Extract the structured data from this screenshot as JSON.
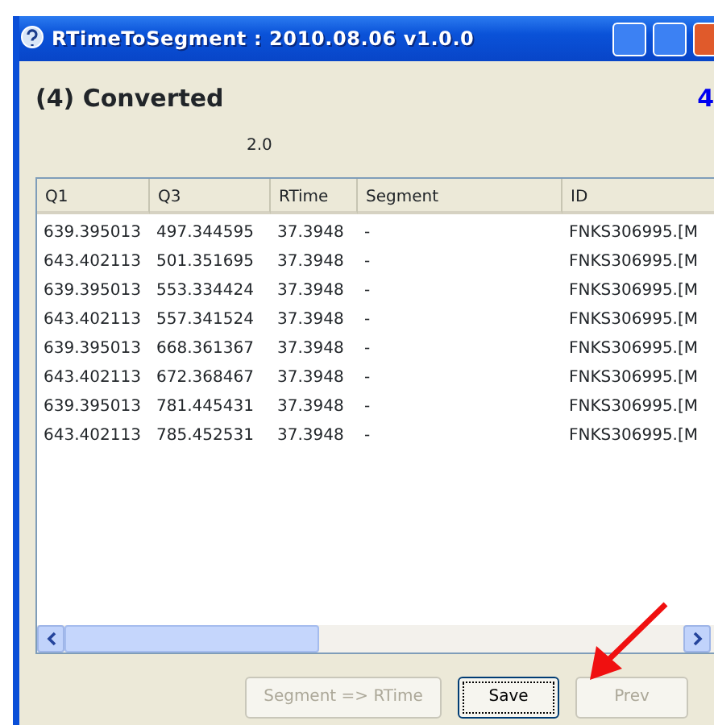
{
  "window": {
    "title": "RTimeToSegment : 2010.08.06 v1.0.0"
  },
  "heading": "(4) Converted",
  "step_number": "4",
  "version_label": "2.0",
  "table": {
    "columns": [
      "Q1",
      "Q3",
      "RTime",
      "Segment",
      "ID"
    ],
    "rows": [
      [
        "639.395013",
        "497.344595",
        "37.3948",
        "-",
        "FNKS306995.[M"
      ],
      [
        "643.402113",
        "501.351695",
        "37.3948",
        "-",
        "FNKS306995.[M"
      ],
      [
        "639.395013",
        "553.334424",
        "37.3948",
        "-",
        "FNKS306995.[M"
      ],
      [
        "643.402113",
        "557.341524",
        "37.3948",
        "-",
        "FNKS306995.[M"
      ],
      [
        "639.395013",
        "668.361367",
        "37.3948",
        "-",
        "FNKS306995.[M"
      ],
      [
        "643.402113",
        "672.368467",
        "37.3948",
        "-",
        "FNKS306995.[M"
      ],
      [
        "639.395013",
        "781.445431",
        "37.3948",
        "-",
        "FNKS306995.[M"
      ],
      [
        "643.402113",
        "785.452531",
        "37.3948",
        "-",
        "FNKS306995.[M"
      ]
    ]
  },
  "buttons": [
    {
      "label": "Segment => RTime",
      "disabled": true,
      "focused": false
    },
    {
      "label": "Save",
      "disabled": false,
      "focused": true
    },
    {
      "label": "Prev",
      "disabled": true,
      "focused": false
    }
  ]
}
